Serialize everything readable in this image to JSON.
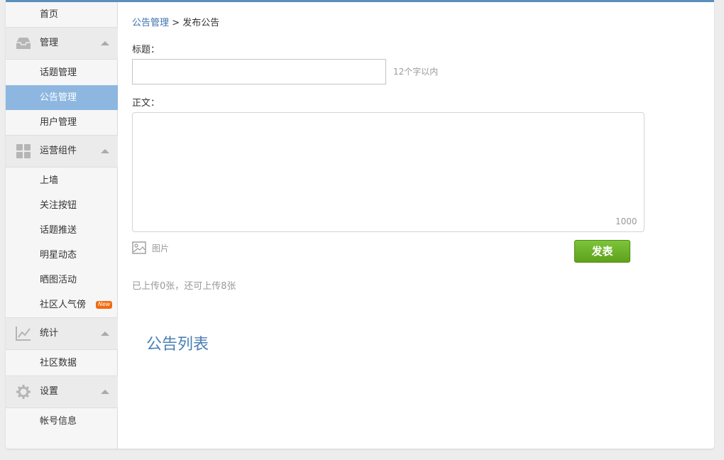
{
  "sidebar": {
    "home": "首页",
    "groups": [
      {
        "name": "管理",
        "icon": "inbox-icon",
        "items": [
          "话题管理",
          "公告管理",
          "用户管理"
        ]
      },
      {
        "name": "运营组件",
        "icon": "grid-icon",
        "items": [
          "上墙",
          "关注按钮",
          "话题推送",
          "明星动态",
          "晒图活动",
          "社区人气傍"
        ]
      },
      {
        "name": "统计",
        "icon": "chart-icon",
        "items": [
          "社区数据"
        ]
      },
      {
        "name": "设置",
        "icon": "gear-icon",
        "items": [
          "帐号信息"
        ]
      }
    ],
    "active_item": "公告管理",
    "new_badge": "New"
  },
  "breadcrumb": {
    "parent": "公告管理",
    "separator": ">",
    "current": "发布公告"
  },
  "form": {
    "title_label": "标题：",
    "title_value": "",
    "title_hint": "12个字以内",
    "body_label": "正文：",
    "body_value": "",
    "char_counter": "1000",
    "image_button": "图片",
    "publish_button": "发表",
    "upload_status": "已上传0张，还可上传8张"
  },
  "list_section": {
    "title": "公告列表"
  },
  "colors": {
    "accent": "#5b8fbd",
    "active_nav": "#8db7e0",
    "link": "#3a73ac",
    "publish_green": "#6db02a",
    "badge_orange": "#f26a0e"
  }
}
